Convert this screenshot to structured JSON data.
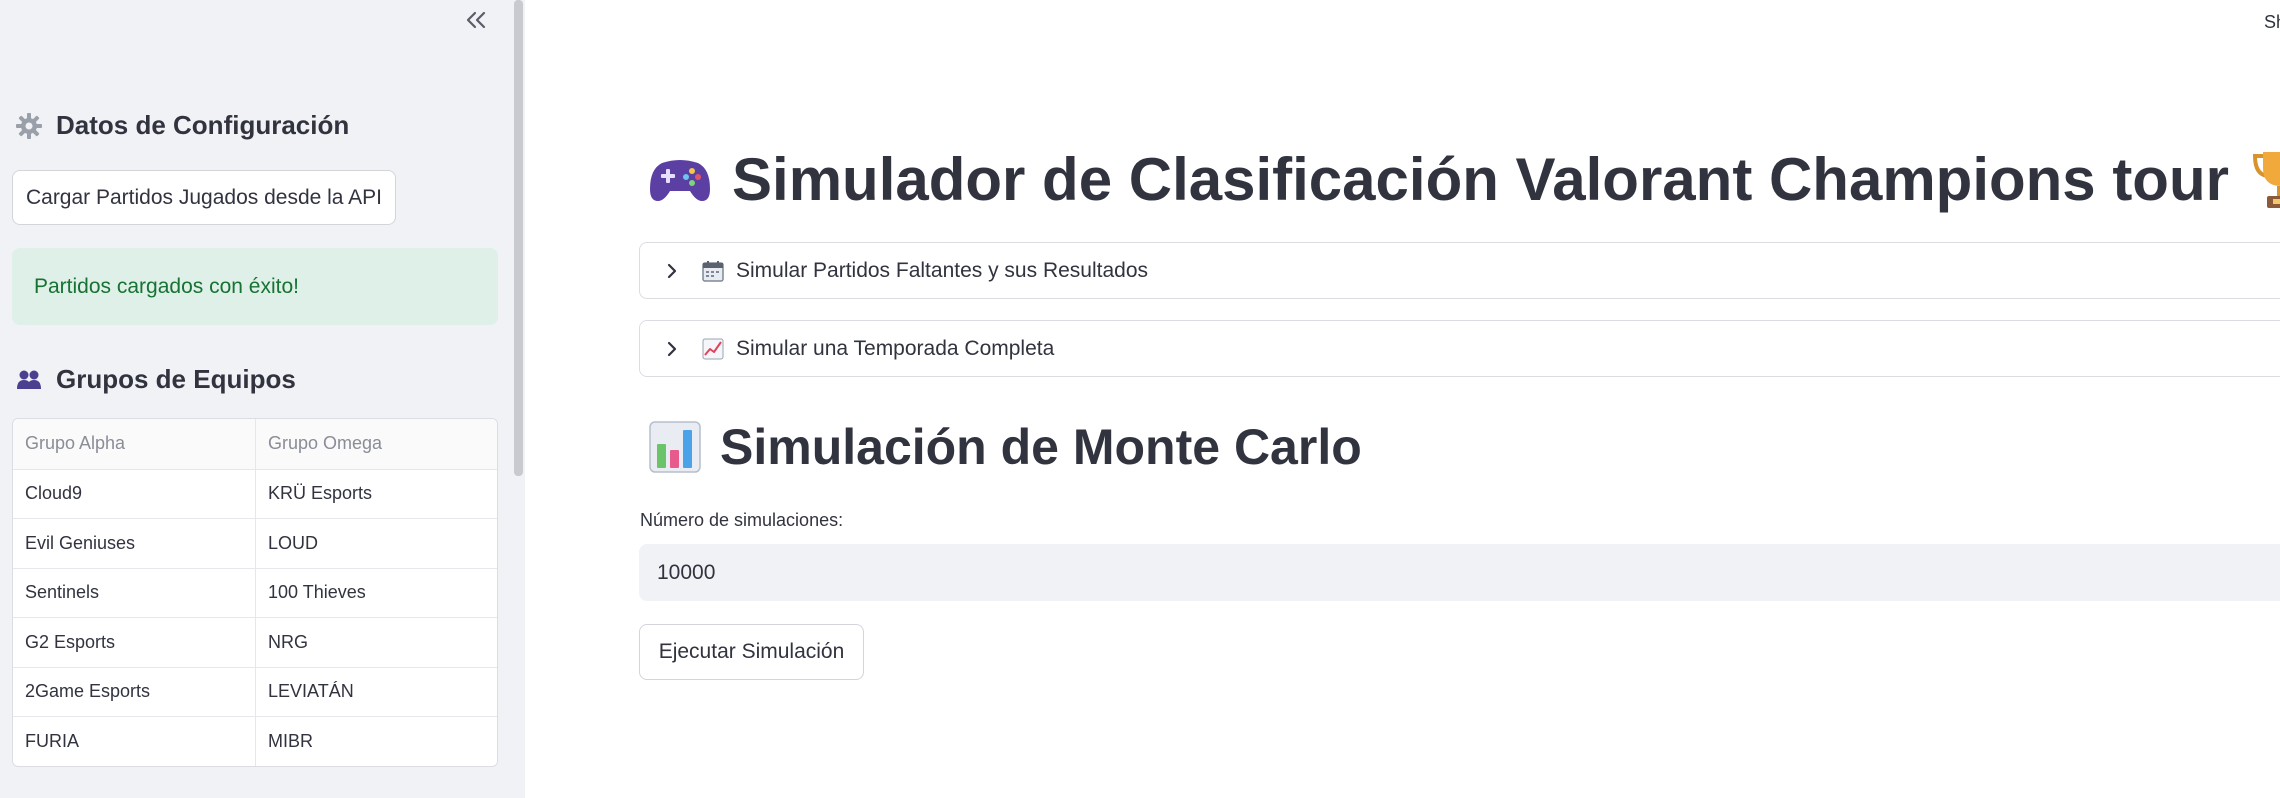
{
  "sidebar": {
    "collapse_icon": "double-chevron-left-icon",
    "config_heading": "Datos de Configuración",
    "config_icon": "gear-icon",
    "load_button": "Cargar Partidos Jugados desde la API",
    "success_message": "Partidos cargados con éxito!",
    "groups_heading": "Grupos de Equipos",
    "groups_icon": "people-icon",
    "groups_table": {
      "headers": [
        "Grupo Alpha",
        "Grupo Omega"
      ],
      "rows": [
        [
          "Cloud9",
          "KRÜ Esports"
        ],
        [
          "Evil Geniuses",
          "LOUD"
        ],
        [
          "Sentinels",
          "100 Thieves"
        ],
        [
          "G2 Esports",
          "NRG"
        ],
        [
          "2Game Esports",
          "LEVIATÁN"
        ],
        [
          "FURIA",
          "MIBR"
        ]
      ]
    }
  },
  "header": {
    "share_label": "Share"
  },
  "main": {
    "title": "Simulador de Clasificación Valorant Champions tour",
    "title_icon_left": "game-controller-icon",
    "title_icon_right": "trophy-icon",
    "expanders": [
      {
        "label": "Simular Partidos Faltantes y sus Resultados",
        "icon": "calendar-icon"
      },
      {
        "label": "Simular una Temporada Completa",
        "icon": "chart-increasing-icon"
      }
    ],
    "monte_carlo": {
      "title": "Simulación de Monte Carlo",
      "icon": "bar-chart-icon",
      "input_label": "Número de simulaciones:",
      "input_value": "10000",
      "run_button": "Ejecutar Simulación"
    }
  },
  "colors": {
    "sidebar_bg": "#f0f2f6",
    "success_bg": "#dff0e8",
    "success_text": "#177233",
    "text": "#31333f"
  }
}
